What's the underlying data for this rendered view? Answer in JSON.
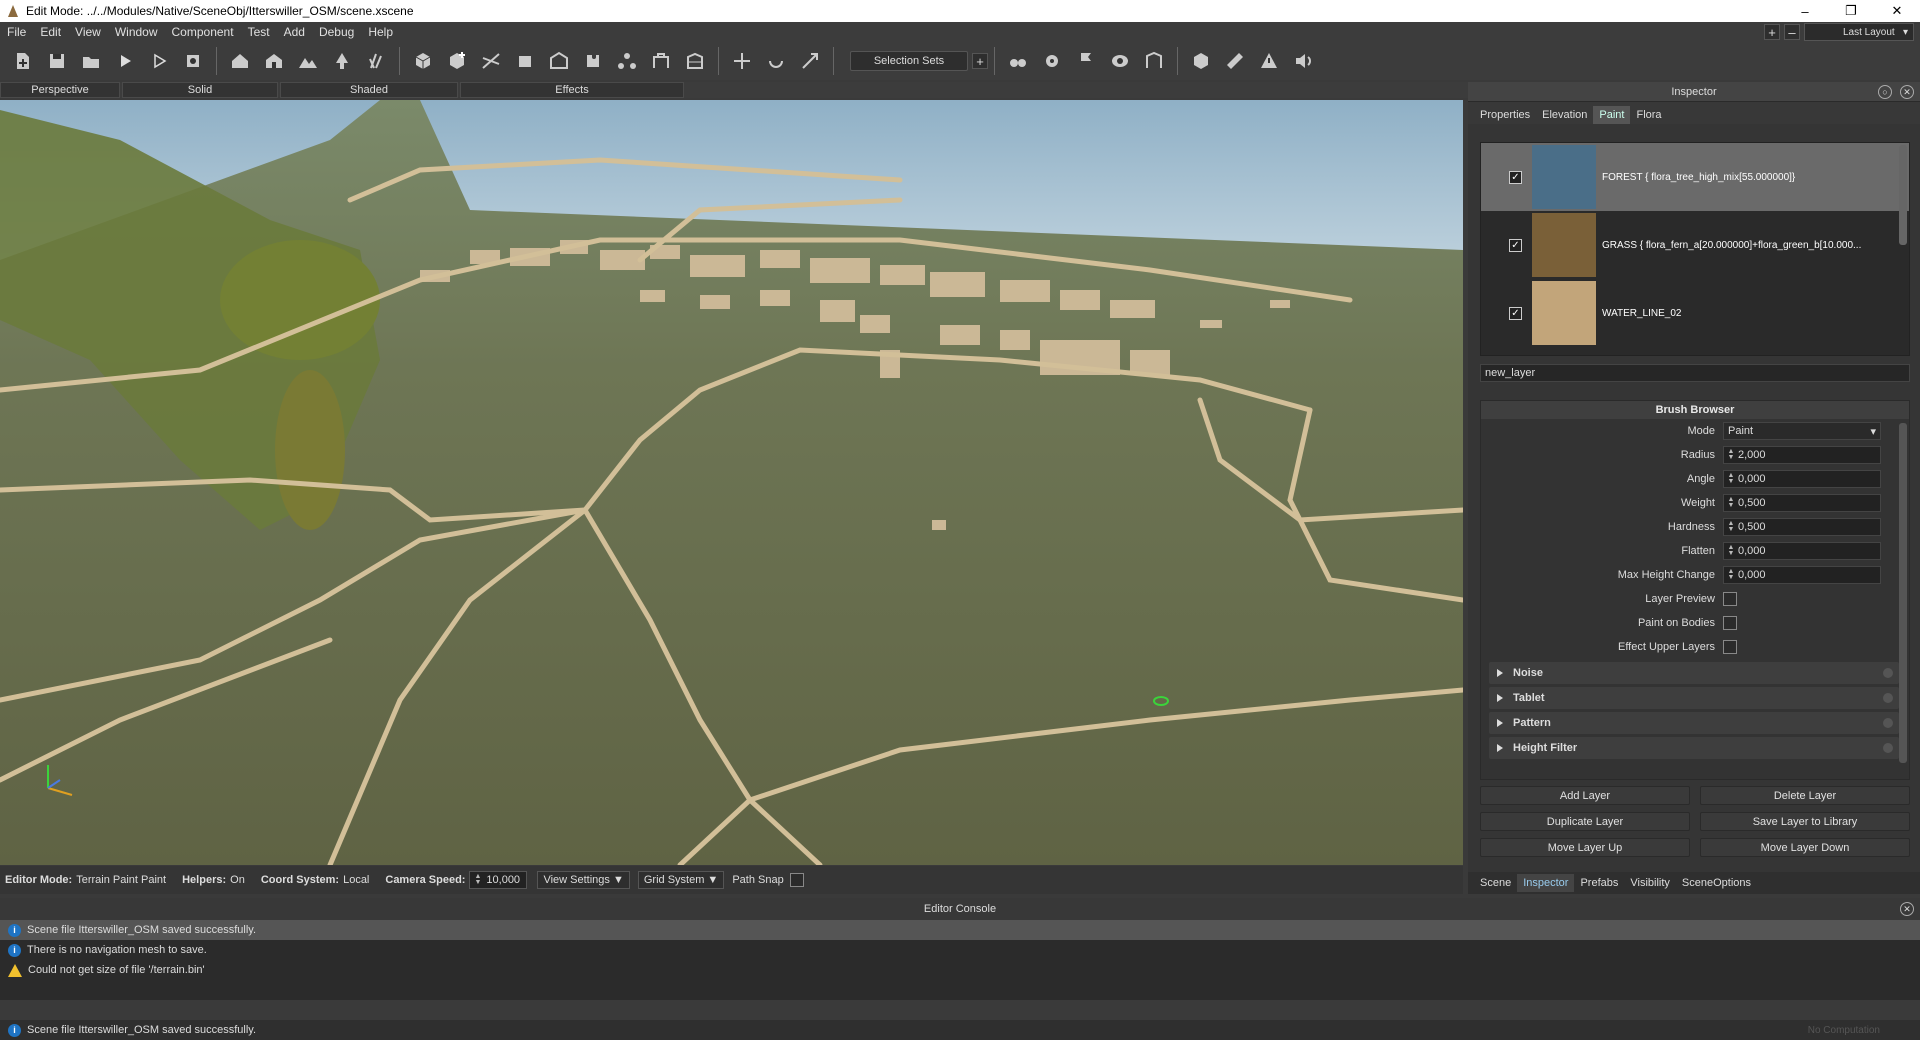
{
  "window": {
    "title": "Edit Mode: ../../Modules/Native/SceneObj/Itterswiller_OSM/scene.xscene",
    "controls": [
      "–",
      "❐",
      "✕"
    ]
  },
  "menu": [
    "File",
    "Edit",
    "View",
    "Window",
    "Component",
    "Test",
    "Add",
    "Debug",
    "Help"
  ],
  "layout": {
    "label": "Last Layout",
    "plus": "+",
    "minus": "–"
  },
  "toolbar": {
    "selection_sets": "Selection Sets",
    "add": "+"
  },
  "viewport_tabs": [
    "Perspective",
    "Solid",
    "Shaded",
    "Effects"
  ],
  "status": {
    "editor_mode_label": "Editor Mode:",
    "editor_mode": "Terrain Paint Paint",
    "helpers_label": "Helpers:",
    "helpers": "On",
    "coord_label": "Coord System:",
    "coord": "Local",
    "speed_label": "Camera Speed:",
    "speed": "10,000",
    "view_settings": "View Settings ▼",
    "grid_system": "Grid System ▼",
    "path_snap": "Path Snap"
  },
  "inspector": {
    "title": "Inspector",
    "tabs": [
      "Properties",
      "Elevation",
      "Paint",
      "Flora"
    ],
    "active_tab": "Paint",
    "layers": [
      {
        "name": "FOREST {  flora_tree_high_mix[55.000000]}",
        "checked": "✓",
        "color": "#4a6e88"
      },
      {
        "name": "GRASS {  flora_fern_a[20.000000]+flora_green_b[10.000...",
        "checked": "✓",
        "color": "#7a6038"
      },
      {
        "name": "WATER_LINE_02",
        "checked": "✓",
        "color": "#c2a57a"
      }
    ],
    "new_layer": "new_layer",
    "brush": {
      "title": "Brush Browser",
      "mode_label": "Mode",
      "mode": "Paint",
      "params": [
        {
          "label": "Radius",
          "value": "2,000"
        },
        {
          "label": "Angle",
          "value": "0,000"
        },
        {
          "label": "Weight",
          "value": "0,500"
        },
        {
          "label": "Hardness",
          "value": "0,500"
        },
        {
          "label": "Flatten",
          "value": "0,000"
        },
        {
          "label": "Max Height Change",
          "value": "0,000"
        }
      ],
      "checks": [
        "Layer Preview",
        "Paint on Bodies",
        "Effect Upper Layers"
      ],
      "sections": [
        "Noise",
        "Tablet",
        "Pattern",
        "Height Filter"
      ]
    },
    "actions": [
      "Add Layer",
      "Delete Layer",
      "Duplicate Layer",
      "Save Layer to Library",
      "Move Layer Up",
      "Move Layer Down"
    ]
  },
  "bottom_tabs": [
    "Scene",
    "Inspector",
    "Prefabs",
    "Visibility",
    "SceneOptions"
  ],
  "console": {
    "title": "Editor Console",
    "messages": [
      {
        "type": "info",
        "text": "Scene file Itterswiller_OSM saved successfully."
      },
      {
        "type": "info",
        "text": "There is no navigation mesh to save."
      },
      {
        "type": "warning",
        "text": "Could not get size of file '/terrain.bin'"
      }
    ]
  },
  "footer": {
    "text": "Scene file Itterswiller_OSM saved successfully.",
    "right": "No Computation"
  },
  "colors": {
    "panel": "#353535",
    "accent": "#1f74c4",
    "warning": "#f2c12e"
  }
}
